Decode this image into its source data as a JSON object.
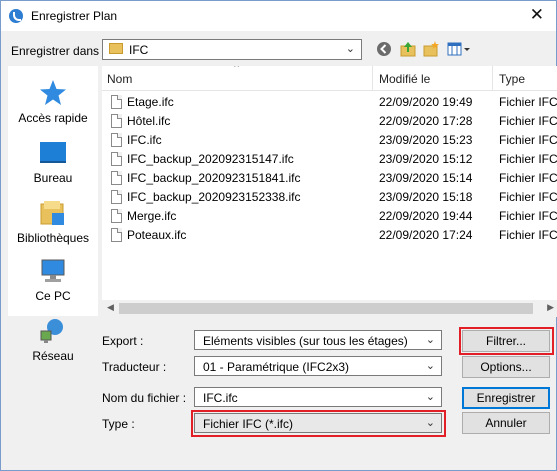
{
  "window": {
    "title": "Enregistrer Plan",
    "close_glyph": "✕"
  },
  "toolbar": {
    "save_in_label": "Enregistrer dans :",
    "location_value": "IFC",
    "icons": [
      "back-icon",
      "up-folder-icon",
      "new-folder-icon",
      "view-menu-icon"
    ]
  },
  "places": [
    {
      "label": "Accès rapide",
      "icon": "quick-access-star-icon"
    },
    {
      "label": "Bureau",
      "icon": "desktop-icon"
    },
    {
      "label": "Bibliothèques",
      "icon": "libraries-icon"
    },
    {
      "label": "Ce PC",
      "icon": "this-pc-icon"
    },
    {
      "label": "Réseau",
      "icon": "network-icon"
    }
  ],
  "filelist": {
    "columns": [
      "Nom",
      "Modifié le",
      "Type"
    ],
    "rows": [
      {
        "name": "Etage.ifc",
        "modified": "22/09/2020 19:49",
        "type": "Fichier IFC"
      },
      {
        "name": "Hôtel.ifc",
        "modified": "22/09/2020 17:28",
        "type": "Fichier IFC"
      },
      {
        "name": "IFC.ifc",
        "modified": "23/09/2020 15:23",
        "type": "Fichier IFC"
      },
      {
        "name": "IFC_backup_202092315147.ifc",
        "modified": "23/09/2020 15:12",
        "type": "Fichier IFC"
      },
      {
        "name": "IFC_backup_2020923151841.ifc",
        "modified": "23/09/2020 15:14",
        "type": "Fichier IFC"
      },
      {
        "name": "IFC_backup_2020923152338.ifc",
        "modified": "23/09/2020 15:18",
        "type": "Fichier IFC"
      },
      {
        "name": "Merge.ifc",
        "modified": "22/09/2020 19:44",
        "type": "Fichier IFC"
      },
      {
        "name": "Poteaux.ifc",
        "modified": "22/09/2020 17:24",
        "type": "Fichier IFC"
      }
    ]
  },
  "form": {
    "export_label": "Export :",
    "export_value": "Eléments visibles (sur tous les étages)",
    "translator_label": "Traducteur :",
    "translator_value": "01 - Paramétrique (IFC2x3)",
    "filename_label": "Nom du fichier :",
    "filename_value": "IFC.ifc",
    "type_label": "Type :",
    "type_value": "Fichier IFC (*.ifc)"
  },
  "buttons": {
    "filter": "Filtrer...",
    "options": "Options...",
    "save": "Enregistrer",
    "cancel": "Annuler"
  },
  "colors": {
    "accent": "#0078d7",
    "highlight": "#e21f26",
    "folder": "#e8c15d"
  }
}
